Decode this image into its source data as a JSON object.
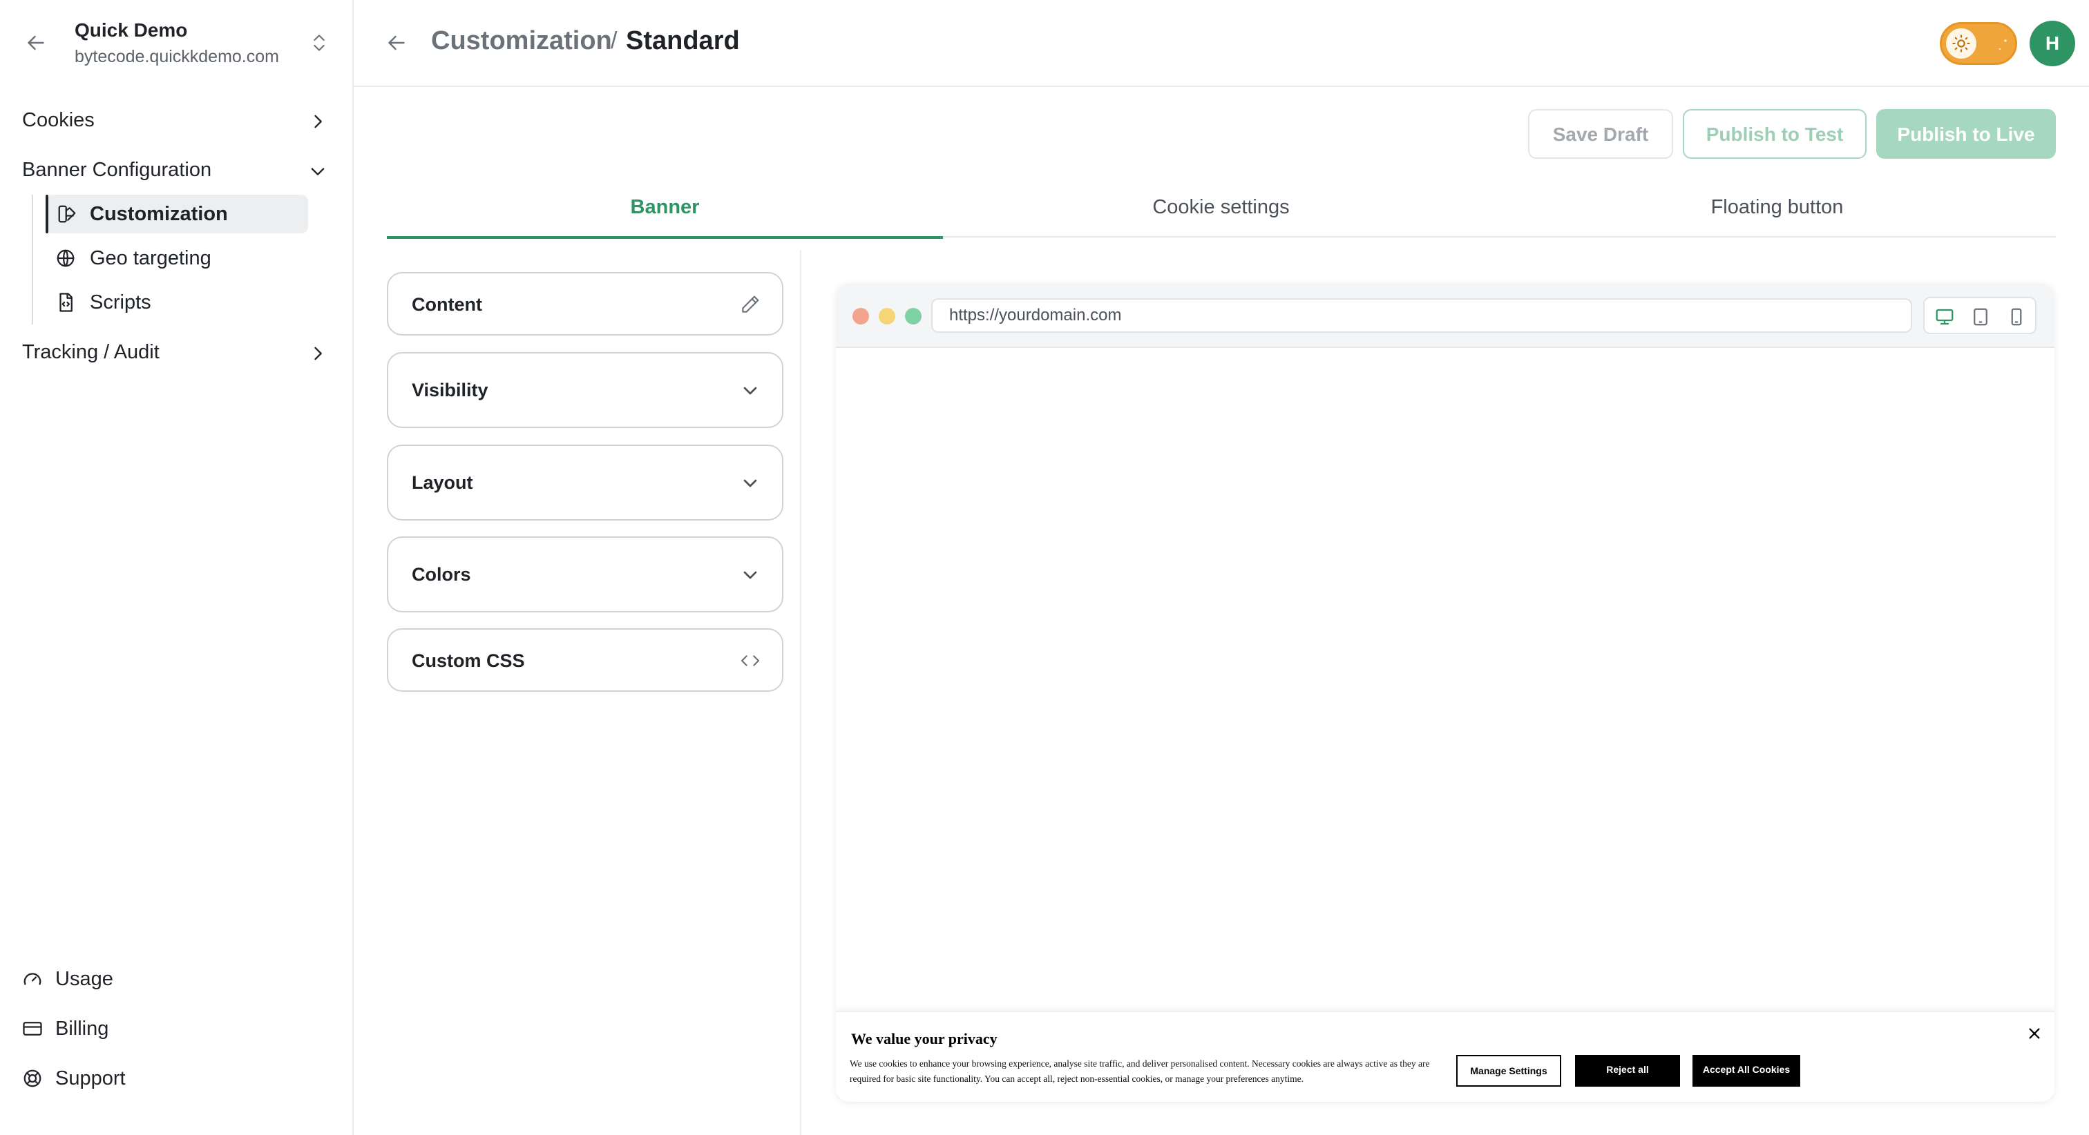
{
  "workspace": {
    "name": "Quick Demo",
    "domain": "bytecode.quickkdemo.com"
  },
  "sidebar": {
    "cookies_label": "Cookies",
    "banner_config_label": "Banner Configuration",
    "sub_items": [
      {
        "label": "Customization",
        "icon": "palette-icon"
      },
      {
        "label": "Geo targeting",
        "icon": "globe-icon"
      },
      {
        "label": "Scripts",
        "icon": "script-file-icon"
      }
    ],
    "tracking_label": "Tracking / Audit",
    "bottom": [
      {
        "label": "Usage",
        "icon": "gauge-icon"
      },
      {
        "label": "Billing",
        "icon": "credit-card-icon"
      },
      {
        "label": "Support",
        "icon": "lifebuoy-icon"
      }
    ]
  },
  "header": {
    "breadcrumb_parent": "Customization",
    "breadcrumb_sep": "/",
    "breadcrumb_current": "Standard",
    "avatar_initial": "H",
    "theme": "light"
  },
  "actions": {
    "save_draft": "Save Draft",
    "publish_test": "Publish to Test",
    "publish_live": "Publish to Live"
  },
  "tabs": [
    {
      "label": "Banner",
      "active": true
    },
    {
      "label": "Cookie settings",
      "active": false
    },
    {
      "label": "Floating button",
      "active": false
    }
  ],
  "panel": {
    "sections": [
      {
        "label": "Content",
        "icon": "pencil-icon"
      },
      {
        "label": "Visibility",
        "icon": "chevron-down-icon"
      },
      {
        "label": "Layout",
        "icon": "chevron-down-icon"
      },
      {
        "label": "Colors",
        "icon": "chevron-down-icon"
      },
      {
        "label": "Custom CSS",
        "icon": "code-icon"
      }
    ]
  },
  "preview": {
    "url": "https://yourdomain.com",
    "devices": [
      "desktop-icon",
      "tablet-icon",
      "mobile-icon"
    ],
    "active_device": "desktop",
    "banner": {
      "title": "We value your privacy",
      "text": "We use cookies to enhance your browsing experience, analyse site traffic, and deliver personalised content. Necessary cookies are always active as they are required for basic site functionality. You can accept all, reject non-essential cookies, or manage your preferences anytime.",
      "manage_label": "Manage Settings",
      "reject_label": "Reject all",
      "accept_label": "Accept All Cookies"
    }
  },
  "colors": {
    "accent": "#2f9464",
    "accent_light": "#a6d8bf",
    "toggle": "#f0a53a"
  }
}
